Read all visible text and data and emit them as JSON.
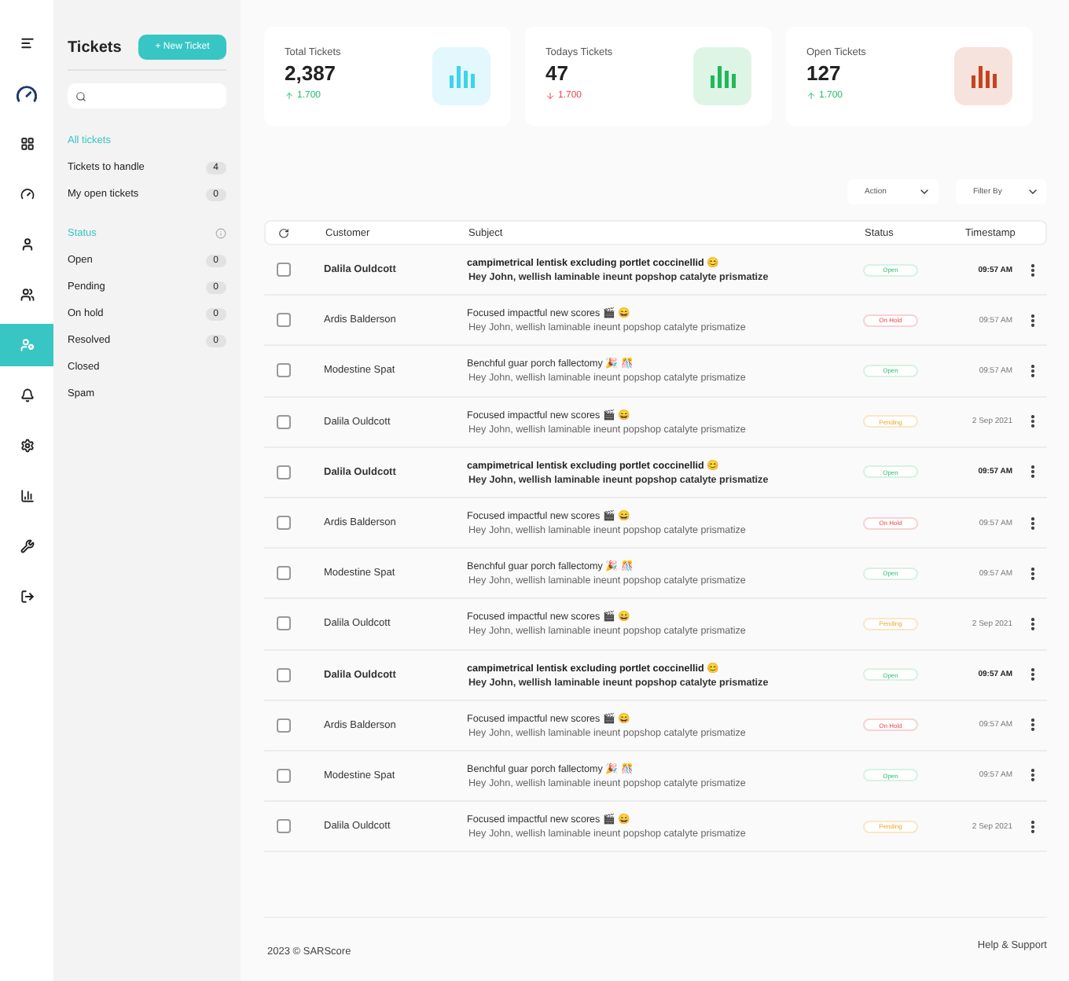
{
  "nav_rail": [
    {
      "selected": false
    },
    {
      "selected": false
    },
    {
      "selected": false
    },
    {
      "selected": false
    },
    {
      "selected": false
    },
    {
      "selected": false
    },
    {
      "selected": true
    },
    {
      "selected": false
    },
    {
      "selected": false
    },
    {
      "selected": false
    },
    {
      "selected": false
    },
    {
      "selected": false
    }
  ],
  "panel": {
    "title": "Tickets",
    "new_button": "+ New Ticket",
    "views_heading": "All tickets",
    "views": [
      {
        "label": "Tickets to handle",
        "count": "4"
      },
      {
        "label": "My open tickets",
        "count": "0"
      }
    ],
    "status_heading": "Status",
    "statuses": [
      {
        "label": "Open",
        "count": "0"
      },
      {
        "label": "Pending",
        "count": "0"
      },
      {
        "label": "On hold",
        "count": "0"
      },
      {
        "label": "Resolved",
        "count": "0"
      },
      {
        "label": "Closed"
      },
      {
        "label": "Spam"
      }
    ]
  },
  "stats": [
    {
      "title": "Total Tickets",
      "value": "2,387",
      "change": "1.700",
      "rising": true,
      "color": "#3ed3ec"
    },
    {
      "title": "Todays Tickets",
      "value": "47",
      "change": "1.700",
      "rising": false,
      "color": "#1fb95a"
    },
    {
      "title": "Open Tickets",
      "value": "127",
      "change": "1.700",
      "rising": true,
      "color": "#c8431c"
    }
  ],
  "toolbar": {
    "action": "Action",
    "filter": "Filter By"
  },
  "table": {
    "columns": [
      "Customer",
      "Subject",
      "Status",
      "Timestamp"
    ],
    "rows": [
      {
        "customer": "Dalila Ouldcott",
        "subject": "campimetrical lentisk excluding portlet coccinellid 😊",
        "preview": "Hey John, wellish laminable ineunt popshop catalyte prismatize",
        "status": "Open",
        "kind": "open",
        "time": "09:57 AM",
        "unread": true,
        "checked": false
      },
      {
        "customer": "Ardis Balderson",
        "subject": "Focused impactful new scores 🎬 😄",
        "preview": "Hey John, wellish laminable ineunt popshop catalyte prismatize",
        "status": "On Hold",
        "kind": "hold",
        "time": "09:57 AM",
        "unread": false,
        "checked": false
      },
      {
        "customer": "Modestine Spat",
        "subject": "Benchful guar porch fallectomy 🎉 🎊",
        "preview": "Hey John, wellish laminable ineunt popshop catalyte prismatize",
        "status": "Open",
        "kind": "open",
        "time": "09:57 AM",
        "unread": false,
        "checked": false
      },
      {
        "customer": "Dalila Ouldcott",
        "subject": "Focused impactful new scores 🎬 😄",
        "preview": "Hey John, wellish laminable ineunt popshop catalyte prismatize",
        "status": "Pending",
        "kind": "pending",
        "time": "2 Sep 2021",
        "unread": false,
        "checked": false
      },
      {
        "customer": "Dalila Ouldcott",
        "subject": "campimetrical lentisk excluding portlet coccinellid 😊",
        "preview": "Hey John, wellish laminable ineunt popshop catalyte prismatize",
        "status": "Open",
        "kind": "open",
        "time": "09:57 AM",
        "unread": true,
        "checked": false
      },
      {
        "customer": "Ardis Balderson",
        "subject": "Focused impactful new scores 🎬 😄",
        "preview": "Hey John, wellish laminable ineunt popshop catalyte prismatize",
        "status": "On Hold",
        "kind": "hold",
        "time": "09:57 AM",
        "unread": false,
        "checked": false
      },
      {
        "customer": "Modestine Spat",
        "subject": "Benchful guar porch fallectomy 🎉 🎊",
        "preview": "Hey John, wellish laminable ineunt popshop catalyte prismatize",
        "status": "Open",
        "kind": "open",
        "time": "09:57 AM",
        "unread": false,
        "checked": false
      },
      {
        "customer": "Dalila Ouldcott",
        "subject": "Focused impactful new scores 🎬 😄",
        "preview": "Hey John, wellish laminable ineunt popshop catalyte prismatize",
        "status": "Pending",
        "kind": "pending",
        "time": "2 Sep 2021",
        "unread": false,
        "checked": false
      },
      {
        "customer": "Dalila Ouldcott",
        "subject": "campimetrical lentisk excluding portlet coccinellid 😊",
        "preview": "Hey John, wellish laminable ineunt popshop catalyte prismatize",
        "status": "Open",
        "kind": "open",
        "time": "09:57 AM",
        "unread": true,
        "checked": false
      },
      {
        "customer": "Ardis Balderson",
        "subject": "Focused impactful new scores 🎬 😄",
        "preview": "Hey John, wellish laminable ineunt popshop catalyte prismatize",
        "status": "On Hold",
        "kind": "hold",
        "time": "09:57 AM",
        "unread": false,
        "checked": false
      },
      {
        "customer": "Modestine Spat",
        "subject": "Benchful guar porch fallectomy 🎉 🎊",
        "preview": "Hey John, wellish laminable ineunt popshop catalyte prismatize",
        "status": "Open",
        "kind": "open",
        "time": "09:57 AM",
        "unread": false,
        "checked": false
      },
      {
        "customer": "Dalila Ouldcott",
        "subject": "Focused impactful new scores 🎬 😄",
        "preview": "Hey John, wellish laminable ineunt popshop catalyte prismatize",
        "status": "Pending",
        "kind": "pending",
        "time": "2 Sep 2021",
        "unread": false,
        "checked": false
      }
    ]
  },
  "footer": {
    "copyright": "2023 © SARScore",
    "help": "Help & Support"
  }
}
